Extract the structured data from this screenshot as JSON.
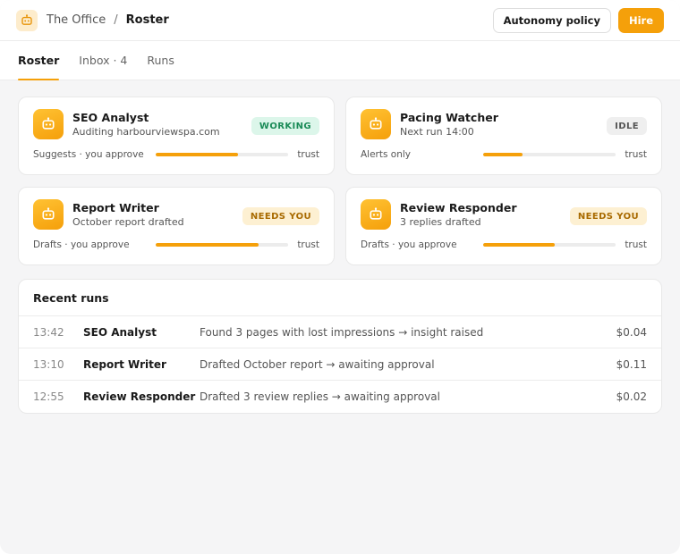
{
  "header": {
    "workspace": "The Office",
    "separator": "/",
    "current": "Roster",
    "autonomy_label": "Autonomy policy",
    "hire_label": "Hire"
  },
  "tabs": [
    {
      "label": "Roster",
      "active": true
    },
    {
      "label": "Inbox · 4",
      "active": false
    },
    {
      "label": "Runs",
      "active": false
    }
  ],
  "colors": {
    "accent": "#f5a00a",
    "working": "#1a8b57",
    "needs": "#a86a00"
  },
  "agents": [
    {
      "name": "SEO Analyst",
      "subtitle": "Auditing harbourviewspa.com",
      "status": "WORKING",
      "status_kind": "working",
      "mode": "Suggests · you approve",
      "trust_label": "trust",
      "trust_level": 0.62,
      "icon": "robot-icon"
    },
    {
      "name": "Pacing Watcher",
      "subtitle": "Next run 14:00",
      "status": "IDLE",
      "status_kind": "idle",
      "mode": "Alerts only",
      "trust_label": "trust",
      "trust_level": 0.3,
      "icon": "robot-icon"
    },
    {
      "name": "Report Writer",
      "subtitle": "October report drafted",
      "status": "NEEDS YOU",
      "status_kind": "needs",
      "mode": "Drafts · you approve",
      "trust_label": "trust",
      "trust_level": 0.78,
      "icon": "robot-icon"
    },
    {
      "name": "Review Responder",
      "subtitle": "3 replies drafted",
      "status": "NEEDS YOU",
      "status_kind": "needs",
      "mode": "Drafts · you approve",
      "trust_label": "trust",
      "trust_level": 0.54,
      "icon": "robot-icon"
    }
  ],
  "recent_runs": {
    "title": "Recent runs",
    "rows": [
      {
        "time": "13:42",
        "agent": "SEO Analyst",
        "description": "Found 3 pages with lost impressions → insight raised",
        "cost": "$0.04"
      },
      {
        "time": "13:10",
        "agent": "Report Writer",
        "description": "Drafted October report → awaiting approval",
        "cost": "$0.11"
      },
      {
        "time": "12:55",
        "agent": "Review Responder",
        "description": "Drafted 3 review replies → awaiting approval",
        "cost": "$0.02"
      }
    ]
  }
}
